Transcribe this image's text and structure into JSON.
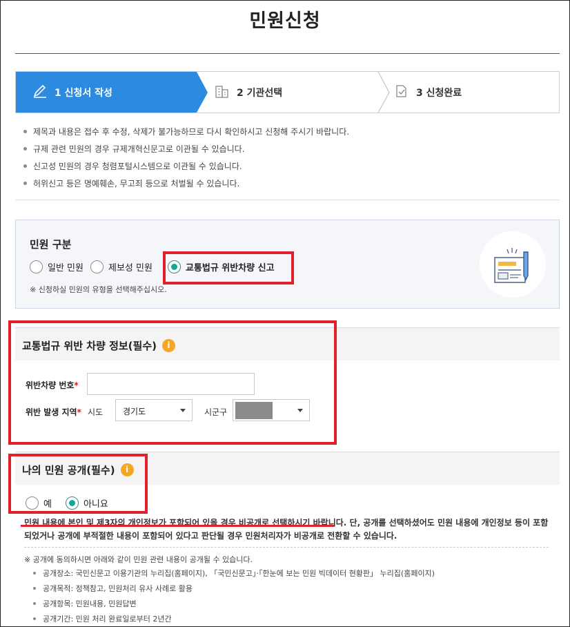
{
  "page": {
    "title": "민원신청"
  },
  "steps": [
    {
      "label": "1 신청서 작성",
      "active": true,
      "icon": "pencil-icon"
    },
    {
      "label": "2 기관선택",
      "active": false,
      "icon": "building-icon"
    },
    {
      "label": "3 신청완료",
      "active": false,
      "icon": "document-check-icon"
    }
  ],
  "notices": [
    "제목과 내용은 접수 후 수정, 삭제가 불가능하므로 다시 확인하시고 신청해 주시기 바랍니다.",
    "규제 관련 민원의 경우 규제개혁신문고로 이관될 수 있습니다.",
    "신고성 민원의 경우 청렴포털시스템으로 이관될 수 있습니다.",
    "허위신고 등은 명예훼손, 무고죄 등으로 처벌될 수 있습니다."
  ],
  "complaint_type": {
    "title": "민원 구분",
    "options": [
      "일반 민원",
      "제보성 민원",
      "교통법규 위반차량 신고"
    ],
    "selected": "교통법규 위반차량 신고",
    "note": "※ 신청하실 민원의 유형을 선택해주십시오."
  },
  "vehicle": {
    "title": "교통법규 위반 차량 정보(필수)",
    "info_icon": "i",
    "plate_label": "위반차량 번호",
    "plate_value": "",
    "region_label": "위반 발생 지역",
    "required_mark": "*",
    "sido_label": "시도",
    "sido_value": "경기도",
    "sigungu_label": "시군구",
    "sigungu_value": ""
  },
  "disclosure": {
    "title": "나의 민원 공개(필수)",
    "info_icon": "i",
    "options": [
      "예",
      "아니요"
    ],
    "selected": "아니요",
    "warning": "민원 내용에 본인 및 제3자의 개인정보가 포함되어 있을 경우 비공개로 선택하시기 바랍니다. 단, 공개를 선택하셨어도 민원 내용에 개인정보 등이 포함되었거나 공개에 부적절한 내용이 포함되어 있다고 판단될 경우 민원처리자가 비공개로 전환할 수 있습니다.",
    "note": "※ 공개에 동의하시면 아래와 같이 민원 관련 내용이 공개될 수 있습니다.",
    "items": [
      "공개장소: 국민신문고 이용기관의 누리집(홈페이지), 「국민신문고」·「한눈에 보는 민원 빅데이터 현황판」 누리집(홈페이지)",
      "공개목적: 정책참고, 민원처리 유사 사례로 활용",
      "공개항목: 민원내용, 민원답변",
      "공개기간: 민원 처리 완료일로부터 2년간"
    ]
  },
  "colors": {
    "accent": "#2c8be0",
    "radio_selected": "#16a39a",
    "highlight": "#e0202a",
    "info": "#f5a623"
  }
}
